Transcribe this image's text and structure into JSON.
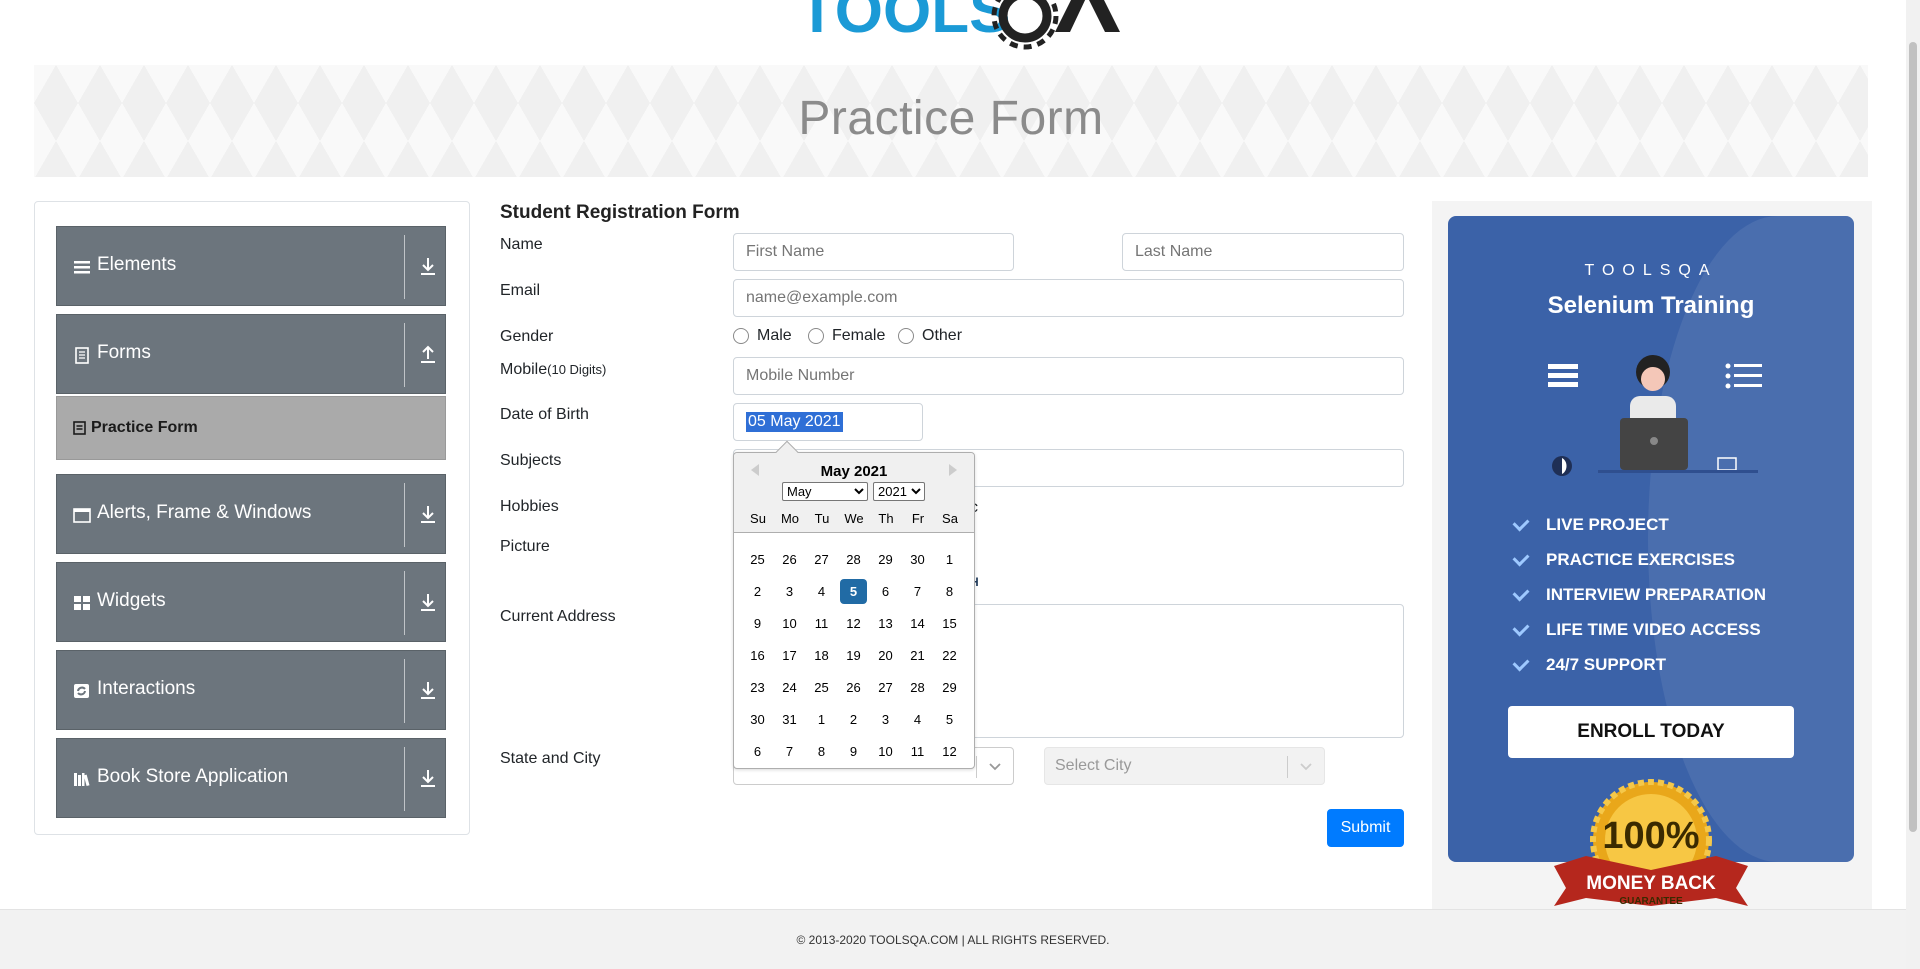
{
  "header": {
    "logo_text": "TOOLSQA"
  },
  "banner": {
    "title": "Practice Form"
  },
  "sidebar": {
    "groups": [
      {
        "label": "Elements",
        "icon": "hamburger-icon"
      },
      {
        "label": "Forms",
        "icon": "document-icon",
        "expanded": true
      },
      {
        "label": "Alerts, Frame & Windows",
        "icon": "window-icon"
      },
      {
        "label": "Widgets",
        "icon": "grid-icon"
      },
      {
        "label": "Interactions",
        "icon": "interaction-icon"
      },
      {
        "label": "Book Store Application",
        "icon": "books-icon"
      }
    ],
    "active_item": "Practice Form"
  },
  "form": {
    "title": "Student Registration Form",
    "labels": {
      "name": "Name",
      "email": "Email",
      "gender": "Gender",
      "mobile": "Mobile",
      "mobile_hint": "(10 Digits)",
      "dob": "Date of Birth",
      "subjects": "Subjects",
      "hobbies": "Hobbies",
      "picture": "Picture",
      "address": "Current Address",
      "state_city": "State and City"
    },
    "placeholders": {
      "first_name": "First Name",
      "last_name": "Last Name",
      "email": "name@example.com",
      "mobile": "Mobile Number"
    },
    "gender_options": [
      "Male",
      "Female",
      "Other"
    ],
    "dob_value": "05 May 2021",
    "hobby_tail": "c",
    "upload_tail": "H",
    "city_placeholder": "Select City",
    "submit": "Submit"
  },
  "datepicker": {
    "title": "May 2021",
    "month_selected": "May",
    "year_selected": "2021",
    "weekdays": [
      "Su",
      "Mo",
      "Tu",
      "We",
      "Th",
      "Fr",
      "Sa"
    ],
    "weeks": [
      [
        "25",
        "26",
        "27",
        "28",
        "29",
        "30",
        "1"
      ],
      [
        "2",
        "3",
        "4",
        "5",
        "6",
        "7",
        "8"
      ],
      [
        "9",
        "10",
        "11",
        "12",
        "13",
        "14",
        "15"
      ],
      [
        "16",
        "17",
        "18",
        "19",
        "20",
        "21",
        "22"
      ],
      [
        "23",
        "24",
        "25",
        "26",
        "27",
        "28",
        "29"
      ],
      [
        "30",
        "31",
        "1",
        "2",
        "3",
        "4",
        "5"
      ],
      [
        "6",
        "7",
        "8",
        "9",
        "10",
        "11",
        "12"
      ]
    ],
    "selected_day": "5"
  },
  "ad": {
    "brand": "TOOLSQA",
    "title": "Selenium Training",
    "features": [
      "LIVE PROJECT",
      "PRACTICE EXERCISES",
      "INTERVIEW PREPARATION",
      "LIFE TIME VIDEO ACCESS",
      "24/7 SUPPORT"
    ],
    "cta": "ENROLL TODAY",
    "badge_top": "100%",
    "badge_ribbon": "MONEY BACK",
    "badge_bottom": "GUARANTEE"
  },
  "footer": {
    "text": "© 2013-2020 TOOLSQA.COM | ALL RIGHTS RESERVED."
  },
  "colors": {
    "primary": "#007bff",
    "sidebar_group": "#6c757d",
    "ad_bg": "#3b62a8",
    "selected_day": "#216ba5"
  }
}
